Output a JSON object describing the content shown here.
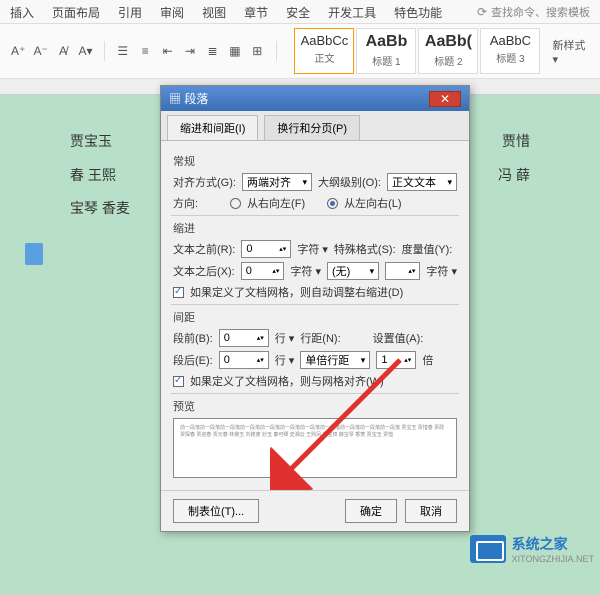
{
  "ribbon": {
    "tabs": [
      "插入",
      "页面布局",
      "引用",
      "审阅",
      "视图",
      "章节",
      "安全",
      "开发工具",
      "特色功能"
    ],
    "search_placeholder": "查找命令、搜索模板"
  },
  "styles": {
    "items": [
      {
        "sample": "AaBbCc",
        "label": "正文"
      },
      {
        "sample": "AaBb",
        "label": "标题 1"
      },
      {
        "sample": "AaBb(",
        "label": "标题 2"
      },
      {
        "sample": "AaBbC",
        "label": "标题 3"
      }
    ],
    "new_style": "新样式 ▾"
  },
  "document": {
    "line1": "贾宝玉",
    "line1_right": "贾惜",
    "line2": "春 王熙",
    "line2_right": "冯 薛",
    "line3": "宝琴 香麦"
  },
  "dialog": {
    "title": "段落",
    "tab1": "缩进和间距(I)",
    "tab2": "换行和分页(P)",
    "general_label": "常规",
    "alignment_label": "对齐方式(G):",
    "alignment_value": "两端对齐",
    "outline_label": "大纲级别(O):",
    "outline_value": "正文文本",
    "direction_label": "方向:",
    "direction_rtl": "从右向左(F)",
    "direction_ltr": "从左向右(L)",
    "indent_label": "缩进",
    "text_before_label": "文本之前(R):",
    "text_before_value": "0",
    "char_unit1": "字符 ▾",
    "special_label": "特殊格式(S):",
    "metric_label": "度量值(Y):",
    "text_after_label": "文本之后(X):",
    "text_after_value": "0",
    "char_unit2": "字符 ▾",
    "special_value": "(无)",
    "char_unit3": "字符 ▾",
    "indent_checkbox": "如果定义了文档网格，则自动调整右缩进(D)",
    "spacing_label": "间距",
    "before_label": "段前(B):",
    "before_value": "0",
    "line_unit1": "行 ▾",
    "linespacing_label": "行距(N):",
    "setvalue_label": "设置值(A):",
    "after_label": "段后(E):",
    "after_value": "0",
    "line_unit2": "行 ▾",
    "linespacing_value": "单倍行距",
    "setvalue_value": "1",
    "bei_unit": "倍",
    "spacing_checkbox": "如果定义了文档网格，则与网格对齐(W)",
    "preview_label": "预览",
    "preview_text": "前一段落前一段落前一段落前一段落前一段落前一段落前一段落前一段落前一段落前一段落前一段落 贾宝玉 贾惜春 贾政 贾探春 贾迎春 贾元春 林黛玉 刘姥婆 妙玉 秦可卿 史湘云 王熙凤 薛宝钗 薛宝琴 香菱 贾宝玉 贾惜",
    "tabstop_btn": "制表位(T)...",
    "ok_btn": "确定",
    "cancel_btn": "取消"
  },
  "watermark": {
    "name": "系统之家",
    "url": "XITONGZHIJIA.NET"
  }
}
